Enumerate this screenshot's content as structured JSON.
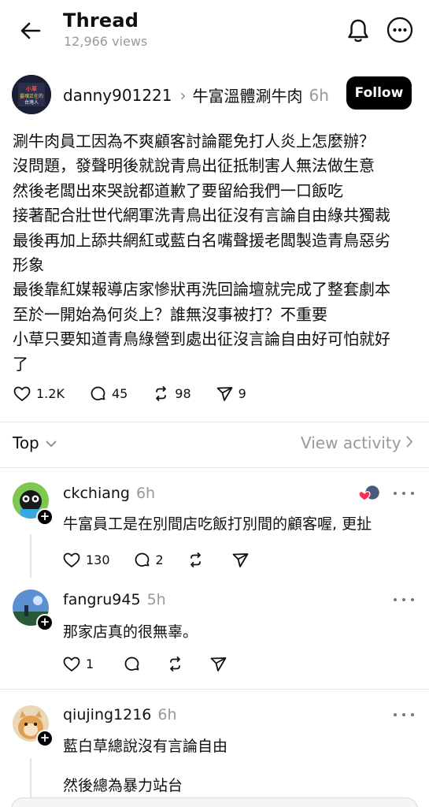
{
  "header": {
    "title": "Thread",
    "views": "12,966 views"
  },
  "post": {
    "username": "danny901221",
    "topic": "牛富溫體涮牛肉",
    "time": "6h",
    "follow_label": "Follow",
    "avatar_text": [
      "小草",
      "靈魂正在的",
      "台灣人"
    ],
    "body_lines": [
      "涮牛肉員工因為不爽顧客討論罷免打人炎上怎麼辦？",
      "沒問題，發聲明後就說青鳥出征抵制害人無法做生意",
      "然後老闆出來哭說都道歉了要留給我們一口飯吃",
      "接著配合壯世代網軍洗青鳥出征沒有言論自由綠共獨裁",
      "最後再加上舔共網紅或藍白名嘴聲援老闆製造青鳥惡劣",
      "形象",
      "最後靠紅媒報導店家慘狀再洗回論壇就完成了整套劇本",
      "至於一開始為何炎上？誰無沒事被打？不重要",
      "小草只要知道青鳥綠營到處出征沒言論自由好可怕就好",
      "了"
    ],
    "likes": "1.2K",
    "comments": "45",
    "reposts": "98",
    "shares": "9"
  },
  "sort": {
    "label": "Top",
    "view_activity": "View activity"
  },
  "replies": [
    {
      "username": "ckchiang",
      "time": "6h",
      "text": "牛富員工是在別間店吃飯打別間的顧客喔, 更扯",
      "likes": "130",
      "comments": "2"
    },
    {
      "username": "fangru945",
      "time": "5h",
      "text": "那家店真的很無辜。",
      "likes": "1",
      "comments": ""
    },
    {
      "username": "qiujing1216",
      "time": "6h",
      "text": "藍白草總說沒有言論自由",
      "text2": "然後總為暴力站台"
    }
  ],
  "colors": {
    "text": "#101010",
    "muted": "#999999",
    "follow_bg": "#000000",
    "divider": "#e6e6e6"
  },
  "icons": [
    "back-arrow-icon",
    "bell-icon",
    "more-circle-icon",
    "heart-icon",
    "comment-icon",
    "repost-icon",
    "share-icon",
    "chevron-down-icon",
    "chevron-right-icon",
    "more-dots-icon",
    "plus-icon"
  ]
}
